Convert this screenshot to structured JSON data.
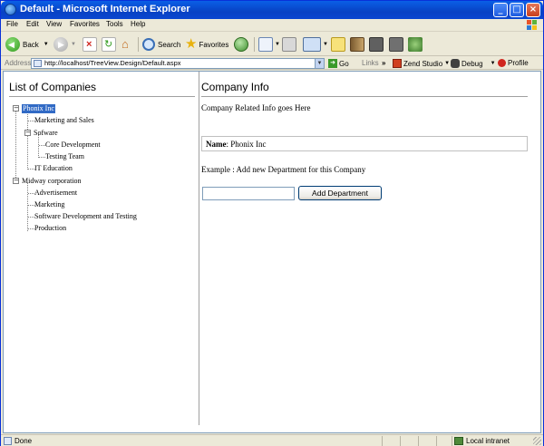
{
  "window": {
    "title": "Default - Microsoft Internet Explorer"
  },
  "menu": [
    "File",
    "Edit",
    "View",
    "Favorites",
    "Tools",
    "Help"
  ],
  "toolbar": {
    "back": "Back",
    "search": "Search",
    "favorites": "Favorites"
  },
  "address": {
    "label": "Address",
    "url": "http://localhost/TreeView.Design/Default.aspx",
    "go": "Go",
    "links": "Links",
    "zend": "Zend Studio",
    "debug": "Debug",
    "profile": "Profile"
  },
  "left": {
    "title": "List of Companies",
    "tree": [
      {
        "label": "Phonix Inc",
        "toggle": "−"
      },
      {
        "label": "Marketing and Sales"
      },
      {
        "label": "Sofware",
        "toggle": "−"
      },
      {
        "label": "Core Development"
      },
      {
        "label": "Testing Team"
      },
      {
        "label": "IT Education"
      },
      {
        "label": "Midway corporation",
        "toggle": "−"
      },
      {
        "label": "Advertisement"
      },
      {
        "label": "Marketing"
      },
      {
        "label": "Software Development and Testing"
      },
      {
        "label": "Production"
      }
    ]
  },
  "right": {
    "title": "Company Info",
    "info": "Company Related Info goes Here",
    "name_label": "Name",
    "name_value": ": Phonix Inc",
    "example": "Example : Add new Department for this Company",
    "department_value": "",
    "add_button": "Add Department"
  },
  "status": {
    "text": "Done",
    "zone": "Local intranet"
  },
  "colors": {
    "titlebar": "#0A5FE6",
    "selection": "#316AC5",
    "window_bg": "#ECE9D8"
  }
}
